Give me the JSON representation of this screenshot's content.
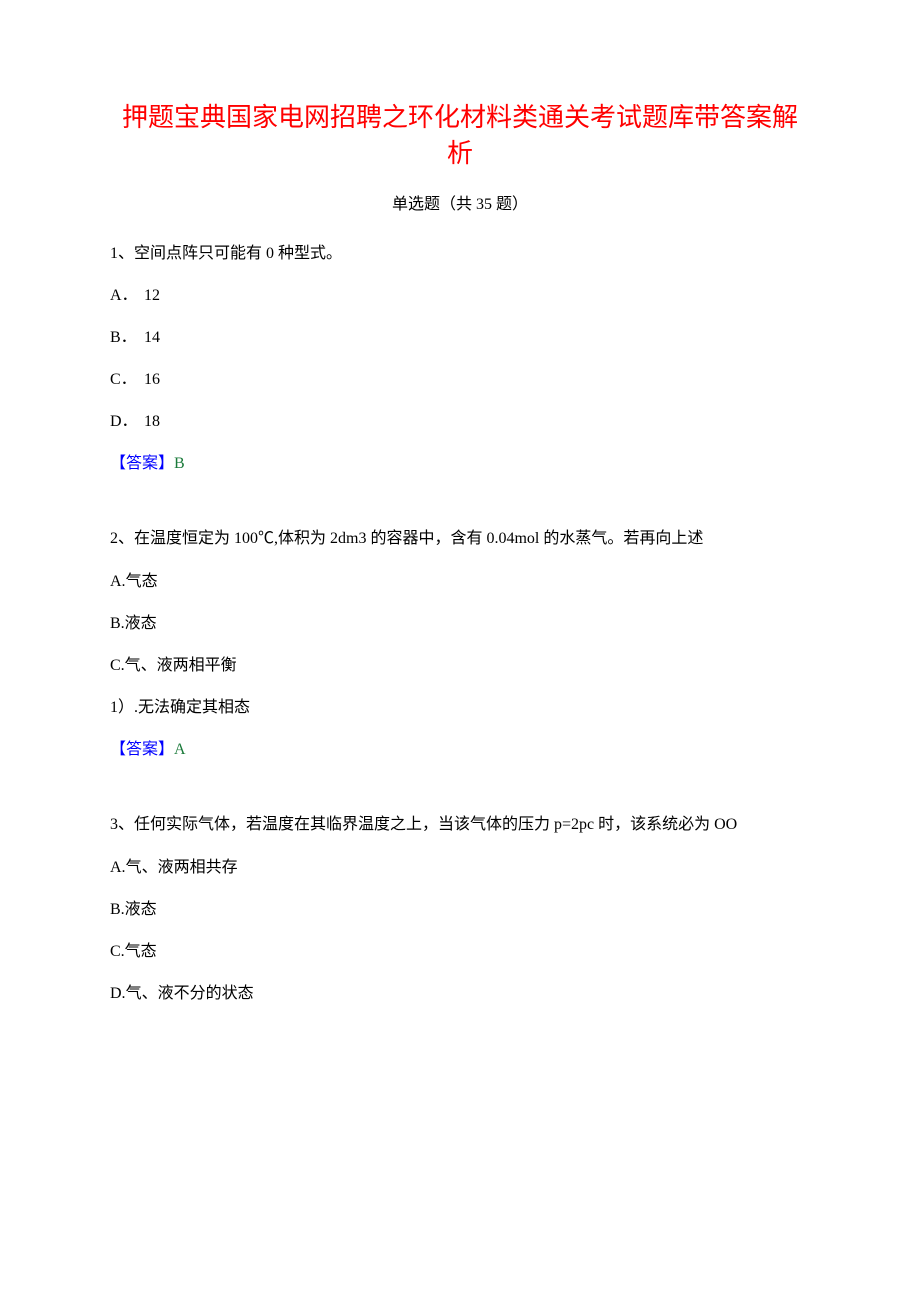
{
  "title": "押题宝典国家电网招聘之环化材料类通关考试题库带答案解析",
  "subtitle": "单选题（共 35 题）",
  "answer_label": "【答案】",
  "questions": [
    {
      "text": "1、空间点阵只可能有 0 种型式。",
      "options": [
        {
          "prefix": "A．",
          "text": "12"
        },
        {
          "prefix": "B．",
          "text": "14"
        },
        {
          "prefix": "C．",
          "text": "16"
        },
        {
          "prefix": "D．",
          "text": "18"
        }
      ],
      "answer": "B"
    },
    {
      "text": "2、在温度恒定为 100℃,体积为 2dm3 的容器中，含有 0.04mol 的水蒸气。若再向上述",
      "options": [
        {
          "prefix": "A.",
          "text": "气态"
        },
        {
          "prefix": "B.",
          "text": "液态"
        },
        {
          "prefix": "C.",
          "text": "气、液两相平衡"
        },
        {
          "prefix": "1）.",
          "text": "无法确定其相态"
        }
      ],
      "answer": "A"
    },
    {
      "text": "3、任何实际气体，若温度在其临界温度之上，当该气体的压力 p=2pc 时，该系统必为 OO",
      "options": [
        {
          "prefix": "A.",
          "text": "气、液两相共存"
        },
        {
          "prefix": "B.",
          "text": "液态"
        },
        {
          "prefix": "C.",
          "text": "气态"
        },
        {
          "prefix": "D.",
          "text": "气、液不分的状态"
        }
      ],
      "answer": null
    }
  ]
}
